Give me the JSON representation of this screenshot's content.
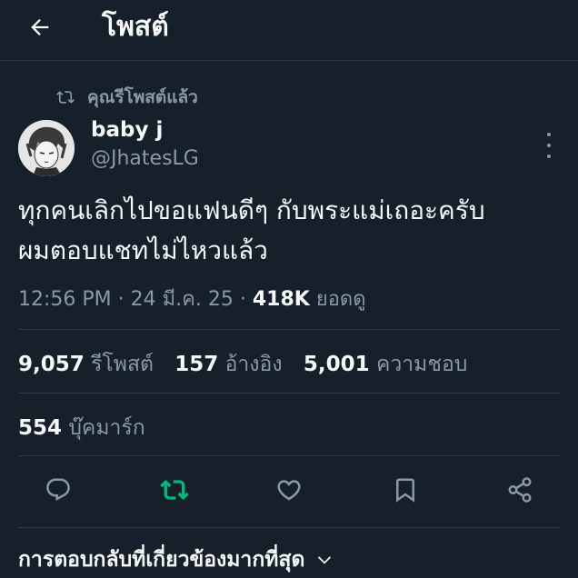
{
  "header": {
    "title": "โพสต์",
    "back_icon": "arrow-left-icon"
  },
  "repost_indicator": {
    "icon": "repost-icon",
    "text": "คุณรีโพสต์แล้ว"
  },
  "author": {
    "display_name": "baby j",
    "handle": "@JhatesLG",
    "avatar": "avatar-drawing"
  },
  "tweet": {
    "text_line1": "ทุกคนเลิกไปขอแฟนดีๆ กับพระแม่เถอะครับ",
    "text_line2": "ผมตอบแชทไม่ไหวแล้ว",
    "time": "12:56 PM",
    "date": "24 มี.ค. 25",
    "views_count": "418K",
    "views_label": "ยอดดู"
  },
  "stats": {
    "reposts_count": "9,057",
    "reposts_label": "รีโพสต์",
    "quotes_count": "157",
    "quotes_label": "อ้างอิง",
    "likes_count": "5,001",
    "likes_label": "ความชอบ",
    "bookmarks_count": "554",
    "bookmarks_label": "บุ๊คมาร์ก"
  },
  "actions": {
    "reply_icon": "reply-icon",
    "repost_icon": "repost-icon",
    "like_icon": "heart-icon",
    "bookmark_icon": "bookmark-icon",
    "share_icon": "share-icon"
  },
  "replies_sort": {
    "label": "การตอบกลับที่เกี่ยวข้องมากที่สุด",
    "icon": "chevron-down-icon"
  },
  "colors": {
    "background": "#15202b",
    "text": "#f7f9f9",
    "secondary_text": "#8b98a5",
    "divider": "#2f3b47",
    "repost_active": "#00ba7c"
  }
}
